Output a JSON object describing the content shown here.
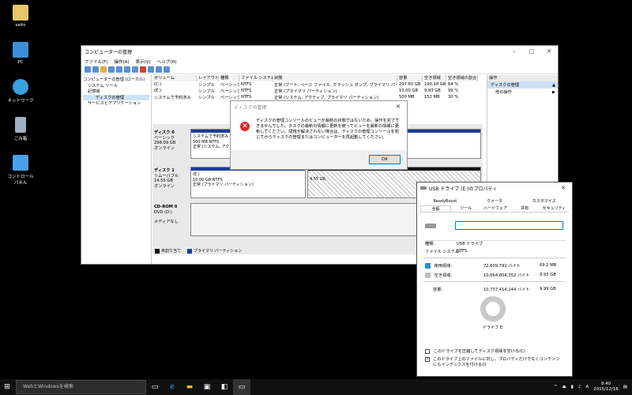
{
  "desktop_icons": [
    {
      "label": "saito",
      "icon": "user-folder-icon"
    },
    {
      "label": "PC",
      "icon": "computer-icon"
    },
    {
      "label": "ネットワーク",
      "icon": "network-icon"
    },
    {
      "label": "ごみ箱",
      "icon": "recycle-bin-icon"
    },
    {
      "label": "コントロール パネル",
      "icon": "control-panel-icon"
    }
  ],
  "mgmt_window": {
    "title": "コンピューターの管理",
    "menu": [
      "ファイル(F)",
      "操作(A)",
      "表示(V)",
      "ヘルプ(H)"
    ],
    "tree": [
      "コンピューターの管理 (ローカル)",
      "システム ツール",
      "記憶域",
      "ディスクの管理",
      "サービスとアプリケーション"
    ],
    "columns": [
      "ボリューム",
      "レイアウト",
      "種類",
      "ファイル システム",
      "状態",
      "容量",
      "空き領域",
      "空き領域の割合"
    ],
    "rows": [
      [
        "(C:)",
        "シンプル",
        "ベーシック",
        "NTFS",
        "正常 (ブート, ページ ファイル, クラッシュ ダンプ, プライマリ パーティション)",
        "297.60 GB",
        "190.18 GB",
        "64 %"
      ],
      [
        "(E:)",
        "シンプル",
        "ベーシック",
        "NTFS",
        "正常 (プライマリ パーティション)",
        "10.00 GB",
        "9.93 GB",
        "99 %"
      ],
      [
        "システムで予約済み",
        "シンプル",
        "ベーシック",
        "NTFS",
        "正常 (システム, アクティブ, プライマリ パーティション)",
        "500 MB",
        "152 MB",
        "30 %"
      ]
    ],
    "actions": {
      "header": "操作",
      "selected": "ディスクの管理",
      "other": "他の操作"
    },
    "disks": {
      "disk0": {
        "name": "ディスク 0",
        "type": "ベーシック",
        "size": "298.09 GB",
        "status": "オンライン",
        "part_name": "システムで予約済み",
        "part_size": "500 MB NTFS",
        "part_status": "正常 (システム, アク"
      },
      "disk1": {
        "name": "ディスク 1",
        "type": "リムーバブル",
        "size": "14.55 GB",
        "status": "オンライン",
        "part_name": "(E:)",
        "part_size": "10.00 GB NTFS",
        "part_status": "正常 (プライマリ パーティション)",
        "unalloc": "4.55 GB"
      },
      "cdrom": {
        "name": "CD-ROM 0",
        "type": "DVD (D:)",
        "status": "メディアなし"
      }
    },
    "legend": [
      "未割り当て",
      "プライマリ パーティション"
    ]
  },
  "dialog": {
    "title": "ディスクの管理",
    "message": "ディスクの管理コンソールのビューが最新の状態ではないため、操作を完了できませんでした。タスクの最新の情報に更新を使ってビューを最新の情報に更新してください。問題が解決されない場合は、ディスクの管理コンソールを閉じてからディスクの管理またはコンピューターを再起動してください。",
    "ok": "OK"
  },
  "props": {
    "title": "USB ドライブ (E:)のプロパティ",
    "tabs_row1": [
      "ReadyBoost",
      "クォータ",
      "カスタマイズ"
    ],
    "tabs_row2": [
      "全般",
      "ツール",
      "ハードウェア",
      "共有",
      "セキュリティ"
    ],
    "type_label": "種類:",
    "type_value": "USB ドライブ",
    "fs_label": "ファイル システム:",
    "fs_value": "NTFS",
    "used_label": "使用領域:",
    "used_bytes": "72,609,792 バイト",
    "used_size": "69.2 MB",
    "free_label": "空き領域:",
    "free_bytes": "10,664,804,352 バイト",
    "free_size": "9.93 GB",
    "cap_label": "容量:",
    "cap_bytes": "10,737,414,144 バイト",
    "cap_size": "9.99 GB",
    "drive_label": "ドライブ E:",
    "check1": "このドライブを圧縮してディスク領域を空ける(C)",
    "check2": "このドライブ上のファイルに対し、プロパティだけでなくコンテンツにもインデックスを付ける(I)"
  },
  "taskbar": {
    "search_placeholder": "WebとWindowsを検索",
    "time": "9:40",
    "date": "2015/12/16",
    "ime": "A"
  }
}
